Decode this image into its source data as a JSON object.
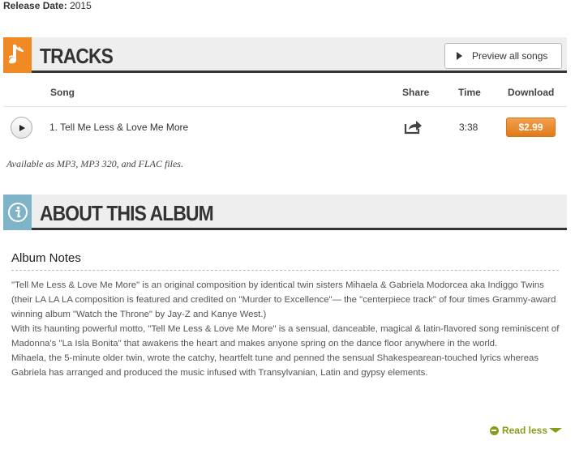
{
  "release": {
    "label": "Release Date:",
    "value": "2015"
  },
  "tracks_section": {
    "title": "TRACKS",
    "icon": "music-note-icon",
    "accent": "#f08a24",
    "preview_label": "Preview all songs"
  },
  "table": {
    "headers": {
      "song": "Song",
      "share": "Share",
      "time": "Time",
      "download": "Download"
    },
    "rows": [
      {
        "title": "1. Tell Me Less & Love Me More",
        "time": "3:38",
        "price": "$2.99"
      }
    ]
  },
  "formats_note": "Available as MP3, MP3 320, and FLAC files.",
  "about_section": {
    "title": "ABOUT THIS ALBUM",
    "icon": "info-icon",
    "accent": "#7fb3c8",
    "notes_title": "Album Notes",
    "paragraphs": [
      "\"Tell Me Less & Love Me More\" is an original composition by identical twin sisters Mihaela & Gabriela Modorcea aka Indiggo Twins (their LA LA LA composition is featured and credited on \"Murder to Excellence\"— the \"centerpiece track\" of four times Grammy-award winning album \"Watch the Throne\" by Jay-Z and Kanye West.)",
      "With its haunting powerful motto, \"Tell Me Less & Love Me More\" is a sensual, danceable, magical & latin-flavored song reminiscent of Madonna's \"La Isla Bonita\" that awakens the heart and makes anyone spring on the dance floor anywhere in the world.",
      "Mihaela, the 5-minute older twin, wrote the catchy, heartfelt tune and penned the sensual Shakespearean-touched lyrics whereas Gabriela has arranged and produced the music infused with Transylvanian, Latin and gypsy elements."
    ],
    "read_less": "Read less"
  }
}
